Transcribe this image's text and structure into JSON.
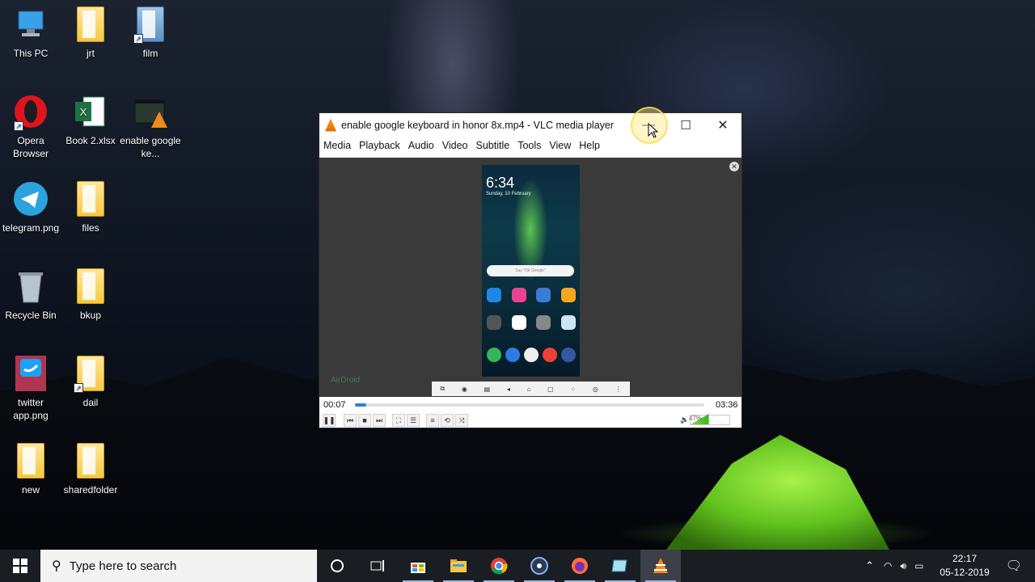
{
  "desktop": {
    "icons": [
      {
        "label": "This PC"
      },
      {
        "label": "jrt"
      },
      {
        "label": "film"
      },
      {
        "label": "Opera Browser"
      },
      {
        "label": "Book 2.xlsx"
      },
      {
        "label": "enable google ke..."
      },
      {
        "label": "telegram.png"
      },
      {
        "label": "files"
      },
      {
        "label": "Recycle Bin"
      },
      {
        "label": "bkup"
      },
      {
        "label": "twitter app.png"
      },
      {
        "label": "dail"
      },
      {
        "label": "new"
      },
      {
        "label": "sharedfolder"
      }
    ]
  },
  "vlc": {
    "title": "enable google keyboard in honor 8x.mp4 - VLC media player",
    "minimize_glyph": "—",
    "maximize_glyph": "☐",
    "close_glyph": "✕",
    "menu": [
      "Media",
      "Playback",
      "Audio",
      "Video",
      "Subtitle",
      "Tools",
      "View",
      "Help"
    ],
    "elapsed": "00:07",
    "duration": "03:36",
    "progress_fraction": 0.032,
    "volume_percent": "47%",
    "volume_fraction": 0.47,
    "phone": {
      "time": "6:34",
      "date": "Sunday, 10 February",
      "search_placeholder": "Say \"Ok Google\"",
      "watermark": "AirDroid"
    }
  },
  "taskbar": {
    "search_placeholder": "Type here to search",
    "clock_time": "22:17",
    "clock_date": "05-12-2019"
  }
}
